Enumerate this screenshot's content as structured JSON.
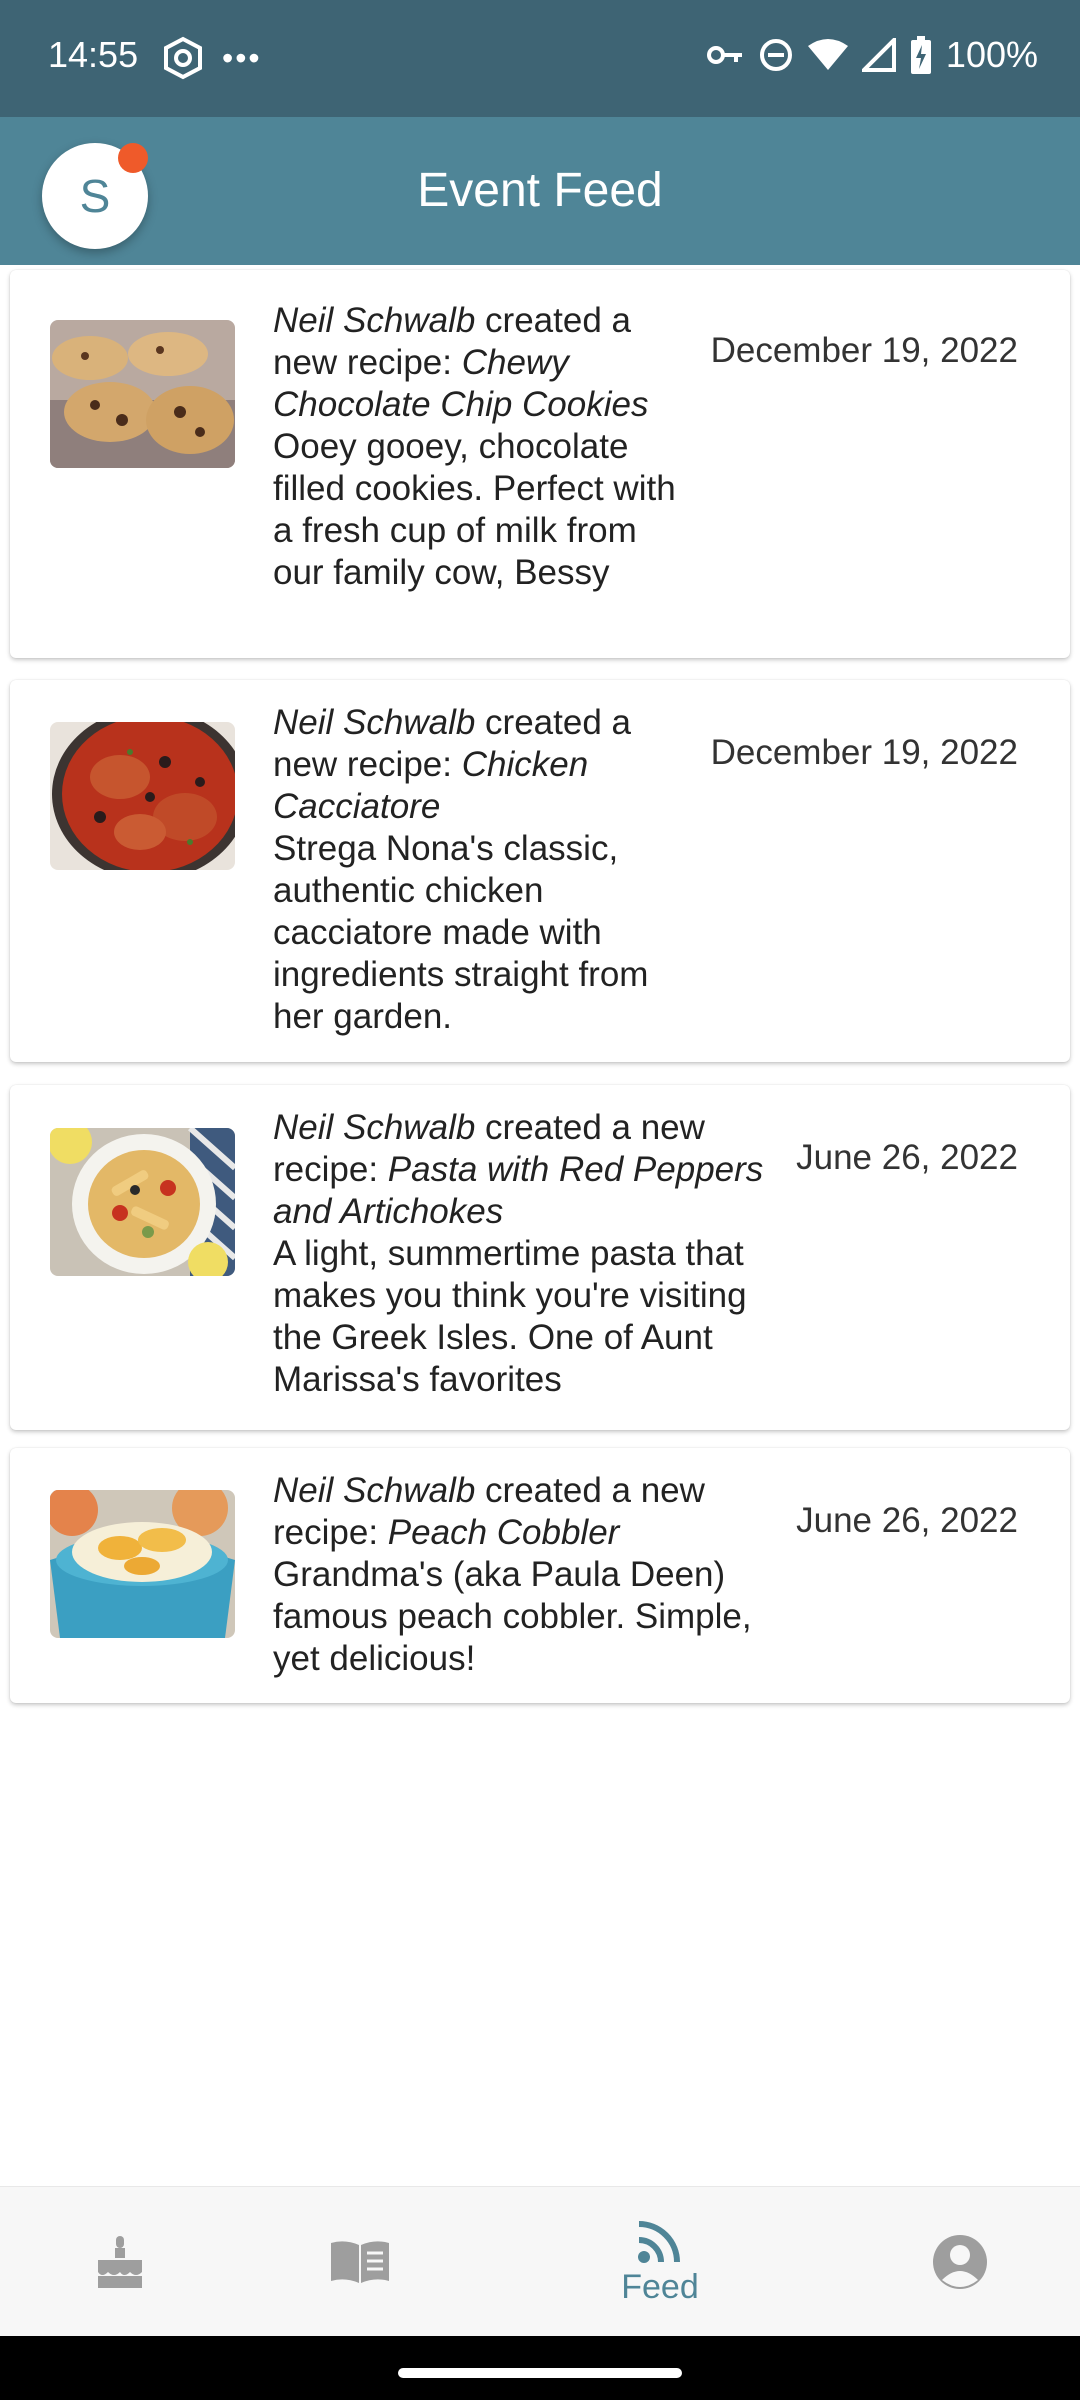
{
  "status": {
    "time": "14:55",
    "battery": "100%",
    "icons": [
      "vpn-icon",
      "more-icon",
      "key-icon",
      "do-not-disturb-icon",
      "wifi-icon",
      "signal-icon",
      "battery-charging-icon"
    ]
  },
  "appbar": {
    "avatar_letter": "S",
    "title": "Event Feed"
  },
  "feed": [
    {
      "author": "Neil Schwalb",
      "action": "created a new recipe:",
      "recipe": "Chewy Chocolate Chip Cookies",
      "description": "Ooey gooey, chocolate filled cookies. Perfect with a fresh cup of milk from our family cow, Bessy",
      "date": "December 19, 2022",
      "image": "chocolate-chip-cookies-photo"
    },
    {
      "author": "Neil Schwalb",
      "action": "created a new recipe:",
      "recipe": "Chicken Cacciatore",
      "description": "Strega Nona's classic, authentic chicken cacciatore made with ingredients straight from her garden.",
      "date": "December 19, 2022",
      "image": "chicken-cacciatore-photo"
    },
    {
      "author": "Neil Schwalb",
      "action": "created a new recipe:",
      "recipe": "Pasta with Red Peppers and Artichokes",
      "description": "A light, summertime pasta that makes you think you're visiting the Greek Isles. One of Aunt Marissa's favorites",
      "date": "June 26, 2022",
      "image": "pasta-photo"
    },
    {
      "author": "Neil Schwalb",
      "action": "created a new recipe:",
      "recipe": "Peach Cobbler",
      "description": "Grandma's (aka Paula Deen) famous peach cobbler. Simple, yet delicious!",
      "date": "June 26, 2022",
      "image": "peach-cobbler-photo"
    }
  ],
  "bottom_nav": {
    "items": [
      {
        "icon": "cake-icon",
        "label": ""
      },
      {
        "icon": "book-icon",
        "label": ""
      },
      {
        "icon": "rss-feed-icon",
        "label": "Feed"
      },
      {
        "icon": "account-icon",
        "label": ""
      }
    ],
    "active_index": 2
  },
  "colors": {
    "status_bar": "#3e6474",
    "app_bar": "#4f8597",
    "accent": "#4f8597",
    "badge": "#ef5a2a",
    "inactive_icon": "#9e9e9e"
  }
}
